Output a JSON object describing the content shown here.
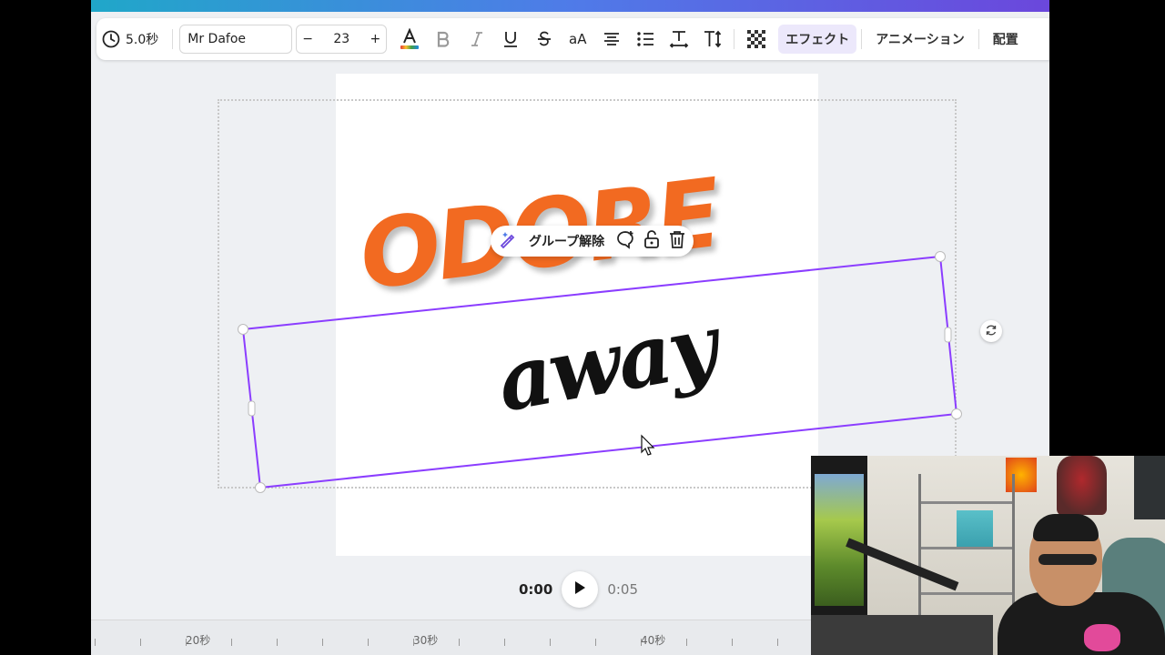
{
  "toolbar": {
    "duration": "5.0秒",
    "font_name": "Mr Dafoe",
    "font_size": "23",
    "size_minus": "−",
    "size_plus": "+",
    "case_label": "aA",
    "effect_label": "エフェクト",
    "animation_label": "アニメーション",
    "position_label": "配置",
    "text_color_bar": "#e84c3d"
  },
  "design": {
    "title_text": "ODORE",
    "subtitle_text": "away",
    "title_color": "#f26a21",
    "subtitle_color": "#111111"
  },
  "context_menu": {
    "ungroup_label": "グループ解除"
  },
  "player": {
    "current_time": "0:00",
    "end_time": "0:05"
  },
  "timeline": {
    "labels": [
      "20秒",
      "30秒",
      "40秒"
    ]
  },
  "colors": {
    "selection": "#8b3dff",
    "accent_bg": "#ece8fb"
  }
}
